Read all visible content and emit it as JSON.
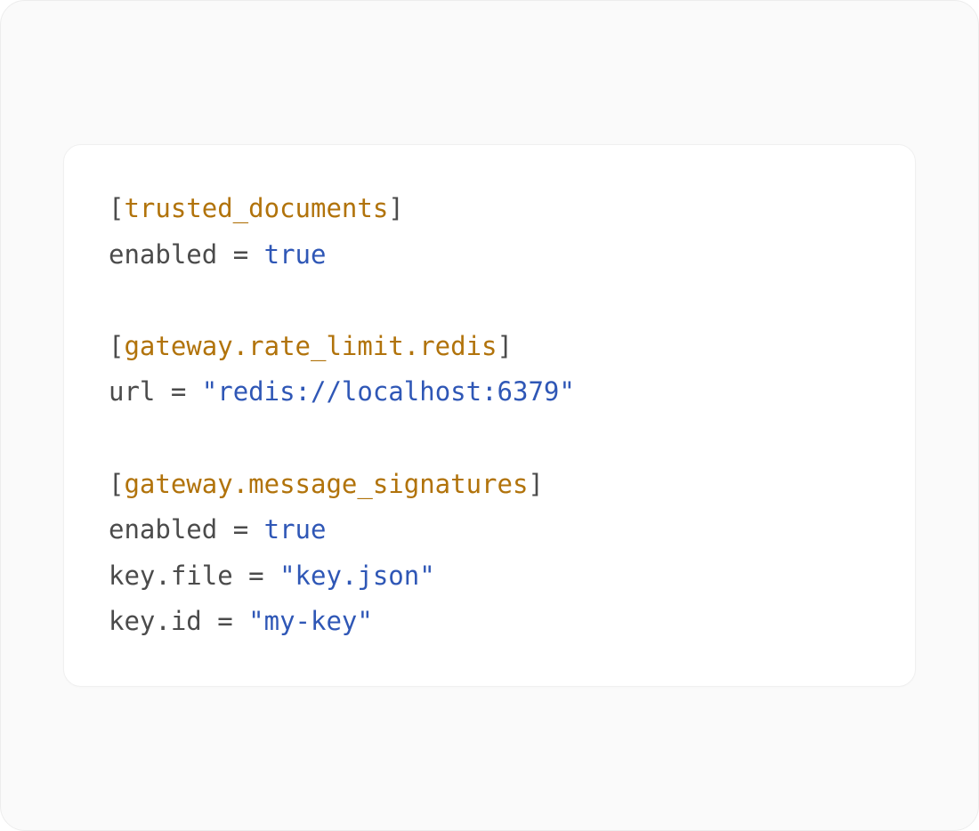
{
  "code": {
    "section1": {
      "name": "trusted_documents",
      "lines": [
        {
          "key": "enabled",
          "value": "true",
          "type": "bool"
        }
      ]
    },
    "section2": {
      "name": "gateway.rate_limit.redis",
      "lines": [
        {
          "key": "url",
          "value": "\"redis://localhost:6379\"",
          "type": "string"
        }
      ]
    },
    "section3": {
      "name": "gateway.message_signatures",
      "lines": [
        {
          "key": "enabled",
          "value": "true",
          "type": "bool"
        },
        {
          "key": "key.file",
          "value": "\"key.json\"",
          "type": "string"
        },
        {
          "key": "key.id",
          "value": "\"my-key\"",
          "type": "string"
        }
      ]
    }
  }
}
